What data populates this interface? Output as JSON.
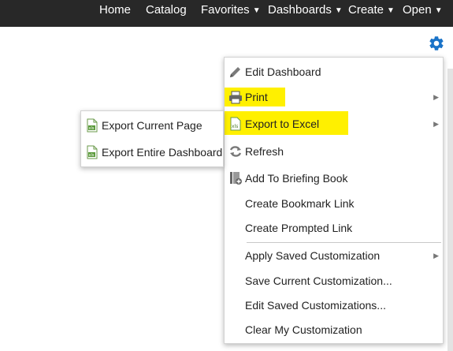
{
  "nav": {
    "home": "Home",
    "catalog": "Catalog",
    "favorites": "Favorites",
    "dashboards": "Dashboards",
    "create": "Create",
    "open": "Open",
    "caret": "▼"
  },
  "page_menu": {
    "icon": "gear-icon",
    "items": [
      {
        "label": "Edit Dashboard",
        "icon": "pencil-icon"
      },
      {
        "label": "Print",
        "icon": "printer-icon",
        "submenu": true,
        "highlighted": true
      },
      {
        "label": "Export to Excel",
        "icon": "excel-icon",
        "submenu": true,
        "highlighted": true
      },
      {
        "label": "Refresh",
        "icon": "refresh-icon"
      },
      {
        "label": "Add To Briefing Book",
        "icon": "briefing-book-icon"
      },
      {
        "label": "Create Bookmark Link"
      },
      {
        "label": "Create Prompted Link"
      },
      {
        "label": "Apply Saved Customization",
        "submenu": true
      },
      {
        "label": "Save Current Customization..."
      },
      {
        "label": "Edit Saved Customizations..."
      },
      {
        "label": "Clear My Customization"
      }
    ]
  },
  "export_submenu": {
    "items": [
      {
        "label": "Export Current Page",
        "icon": "excel-file-icon"
      },
      {
        "label": "Export Entire Dashboard",
        "icon": "excel-file-icon"
      }
    ]
  },
  "colors": {
    "topbar": "#282828",
    "highlight": "#fff000",
    "gear": "#1a73c8"
  }
}
